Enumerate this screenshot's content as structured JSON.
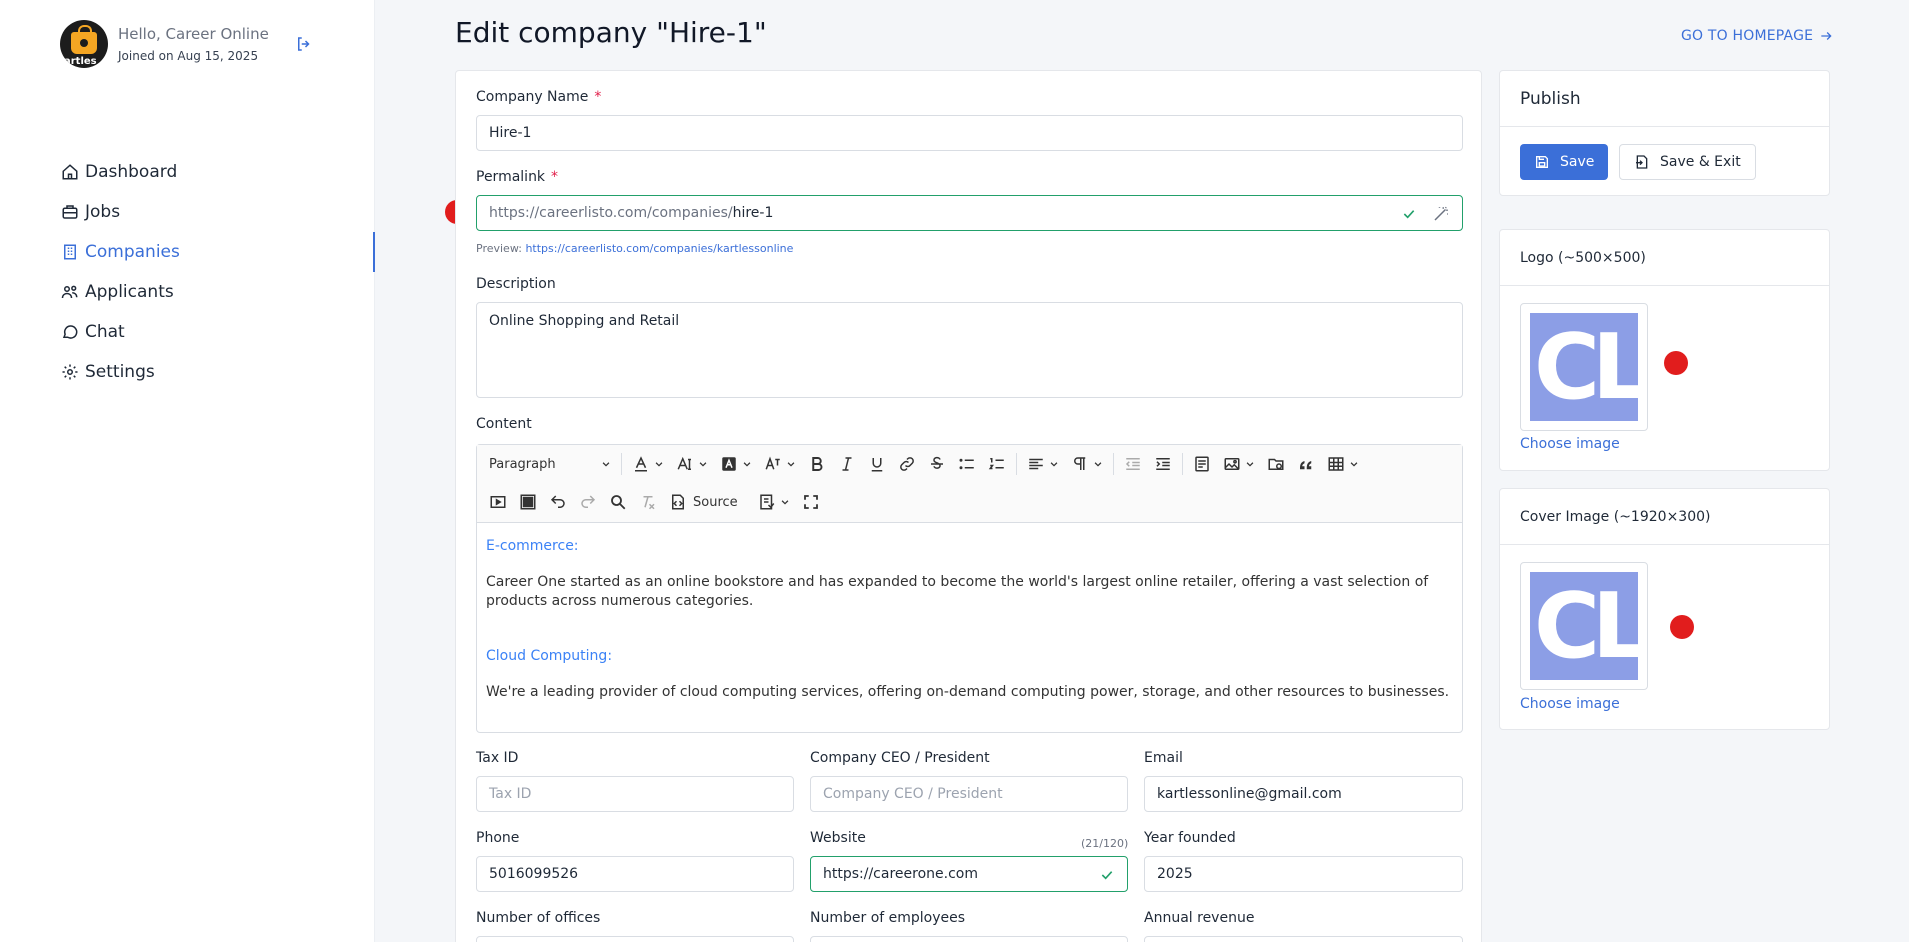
{
  "profile": {
    "greeting": "Hello, Career Online",
    "joined": "Joined on Aug 15, 2025",
    "avatar_text": "artles"
  },
  "nav": [
    {
      "label": "Dashboard",
      "icon": "home-icon"
    },
    {
      "label": "Jobs",
      "icon": "briefcase-icon"
    },
    {
      "label": "Companies",
      "icon": "building-icon",
      "active": true
    },
    {
      "label": "Applicants",
      "icon": "users-icon"
    },
    {
      "label": "Chat",
      "icon": "chat-icon"
    },
    {
      "label": "Settings",
      "icon": "gear-icon"
    }
  ],
  "header": {
    "title": "Edit company \"Hire-1\"",
    "home_link": "GO TO HOMEPAGE"
  },
  "form": {
    "company_name_label": "Company Name",
    "company_name_value": "Hire-1",
    "permalink_label": "Permalink",
    "permalink_prefix": "https://careerlisto.com/companies/",
    "permalink_slug": "hire-1",
    "preview_label": "Preview:",
    "preview_url": "https://careerlisto.com/companies/kartlessonline",
    "description_label": "Description",
    "description_value": "Online Shopping and Retail",
    "content_label": "Content",
    "toolbar": {
      "paragraph": "Paragraph",
      "source": "Source"
    },
    "content": {
      "h1": "E-commerce:",
      "p1": "Career One started as an online bookstore and has expanded to become the world's largest online retailer, offering a vast selection of products across numerous categories.",
      "h2": "Cloud Computing:",
      "p2": "We're a leading provider of cloud computing services, offering on-demand computing power, storage, and other resources to businesses."
    },
    "tax_id_label": "Tax ID",
    "tax_id_placeholder": "Tax ID",
    "ceo_label": "Company CEO / President",
    "ceo_placeholder": "Company CEO / President",
    "email_label": "Email",
    "email_value": "kartlessonline@gmail.com",
    "phone_label": "Phone",
    "phone_value": "5016099526",
    "website_label": "Website",
    "website_counter": "(21/120)",
    "website_value": "https://careerone.com",
    "year_label": "Year founded",
    "year_value": "2025",
    "offices_label": "Number of offices",
    "employees_label": "Number of employees",
    "revenue_label": "Annual revenue"
  },
  "publish": {
    "title": "Publish",
    "save": "Save",
    "save_exit": "Save & Exit"
  },
  "logo": {
    "title": "Logo (~500×500)",
    "choose": "Choose image",
    "img_text": "CL"
  },
  "cover": {
    "title": "Cover Image (~1920×300)",
    "choose": "Choose image",
    "img_text": "CL"
  },
  "colors": {
    "accent": "#3b6fd8",
    "success": "#22a06b",
    "marker": "#e11d1d"
  }
}
